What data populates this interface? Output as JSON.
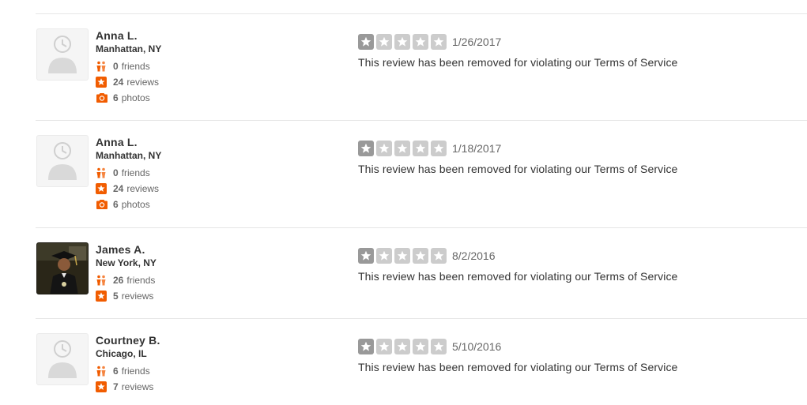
{
  "reviews": [
    {
      "user": {
        "name": "Anna L.",
        "location": "Manhattan, NY",
        "avatar": "default-avatar-icon",
        "stats": [
          {
            "icon": "friends-icon",
            "value": "0",
            "label": "friends"
          },
          {
            "icon": "reviews-star-icon",
            "value": "24",
            "label": "reviews"
          },
          {
            "icon": "camera-icon",
            "value": "6",
            "label": "photos"
          }
        ]
      },
      "rating": 1,
      "rating_max": 5,
      "date": "1/26/2017",
      "text": "This review has been removed for violating our Terms of Service"
    },
    {
      "user": {
        "name": "Anna L.",
        "location": "Manhattan, NY",
        "avatar": "default-avatar-icon",
        "stats": [
          {
            "icon": "friends-icon",
            "value": "0",
            "label": "friends"
          },
          {
            "icon": "reviews-star-icon",
            "value": "24",
            "label": "reviews"
          },
          {
            "icon": "camera-icon",
            "value": "6",
            "label": "photos"
          }
        ]
      },
      "rating": 1,
      "rating_max": 5,
      "date": "1/18/2017",
      "text": "This review has been removed for violating our Terms of Service"
    },
    {
      "user": {
        "name": "James A.",
        "location": "New York, NY",
        "avatar": "user-photo",
        "stats": [
          {
            "icon": "friends-icon",
            "value": "26",
            "label": "friends"
          },
          {
            "icon": "reviews-star-icon",
            "value": "5",
            "label": "reviews"
          }
        ]
      },
      "rating": 1,
      "rating_max": 5,
      "date": "8/2/2016",
      "text": "This review has been removed for violating our Terms of Service"
    },
    {
      "user": {
        "name": "Courtney B.",
        "location": "Chicago, IL",
        "avatar": "default-avatar-icon",
        "stats": [
          {
            "icon": "friends-icon",
            "value": "6",
            "label": "friends"
          },
          {
            "icon": "reviews-star-icon",
            "value": "7",
            "label": "reviews"
          }
        ]
      },
      "rating": 1,
      "rating_max": 5,
      "date": "5/10/2016",
      "text": "This review has been removed for violating our Terms of Service"
    }
  ],
  "colors": {
    "accent": "#f15c00",
    "star_filled": "#999999",
    "star_empty": "#cccccc",
    "divider": "#e6e6e6",
    "text": "#333333",
    "muted": "#666666"
  }
}
